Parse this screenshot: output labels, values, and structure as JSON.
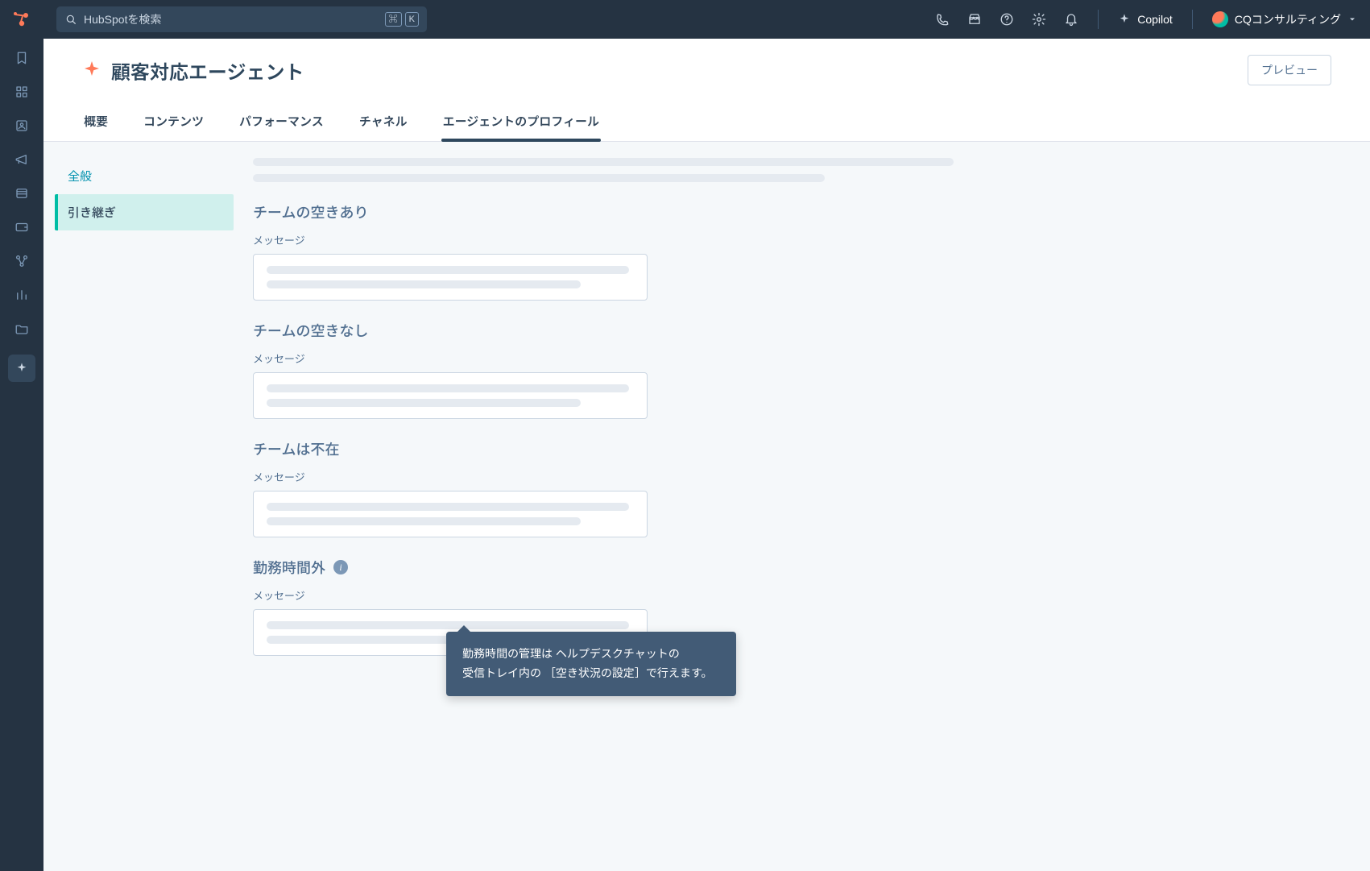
{
  "search": {
    "placeholder": "HubSpotを検索",
    "shortcut_keys": [
      "⌘",
      "K"
    ]
  },
  "topbar": {
    "copilot": "Copilot",
    "account_name": "CQコンサルティング"
  },
  "page": {
    "title": "顧客対応エージェント",
    "preview_button": "プレビュー",
    "tabs": [
      "概要",
      "コンテンツ",
      "パフォーマンス",
      "チャネル",
      "エージェントのプロフィール"
    ],
    "active_tab_index": 4
  },
  "sidenav": {
    "items": [
      "全般",
      "引き継ぎ"
    ],
    "active_index": 1
  },
  "sections": {
    "0": {
      "title": "チームの空きあり",
      "field_label": "メッセージ"
    },
    "1": {
      "title": "チームの空きなし",
      "field_label": "メッセージ"
    },
    "2": {
      "title": "チームは不在",
      "field_label": "メッセージ"
    },
    "3": {
      "title": "勤務時間外",
      "field_label": "メッセージ"
    }
  },
  "tooltip": {
    "line1": "勤務時間の管理は ヘルプデスクチャットの",
    "line2": "受信トレイ内の ［空き状況の設定］で行えます。"
  }
}
